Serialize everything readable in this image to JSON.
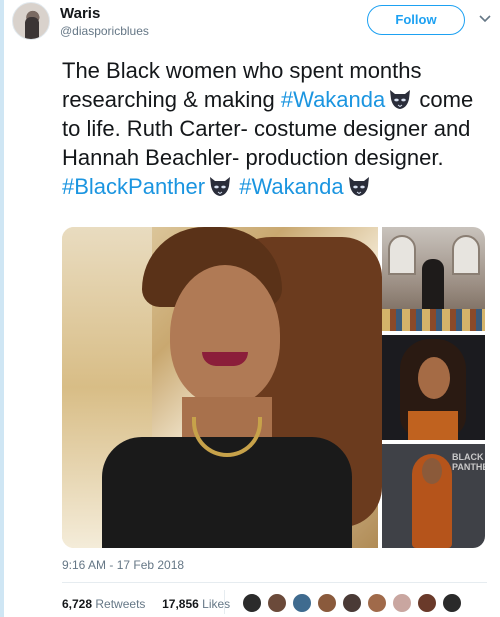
{
  "user": {
    "name": "Waris",
    "handle": "@diasporicblues"
  },
  "follow_button_label": "Follow",
  "tweet": {
    "segments": [
      {
        "text": "The Black women who spent months researching & making ",
        "type": "text"
      },
      {
        "text": "#Wakanda",
        "type": "hashtag"
      },
      {
        "text": "panther-emoji",
        "type": "emoji"
      },
      {
        "text": " come to life. Ruth Carter- costume designer and Hannah Beachler- production designer. ",
        "type": "text"
      },
      {
        "text": "#BlackPanther",
        "type": "hashtag"
      },
      {
        "text": "panther-emoji",
        "type": "emoji"
      },
      {
        "text": " ",
        "type": "text"
      },
      {
        "text": "#Wakanda",
        "type": "hashtag"
      },
      {
        "text": "panther-emoji",
        "type": "emoji"
      }
    ],
    "part1": "The Black women who spent months researching & making ",
    "hashtag1": "#Wakanda",
    "part2": " come to life. Ruth Carter- costume designer and Hannah Beachler- production designer. ",
    "hashtag2": "#BlackPanther",
    "hashtag3": "#Wakanda"
  },
  "media": {
    "main_photo": "woman-smiling-photo",
    "side_photos": [
      "studio-photo",
      "portrait-photo",
      "premiere-photo"
    ],
    "premiere_text": "BLACK PANTHER"
  },
  "timestamp": "9:16 AM - 17 Feb 2018",
  "stats": {
    "retweets_count": "6,728",
    "retweets_label": "Retweets",
    "likes_count": "17,856",
    "likes_label": "Likes"
  },
  "likers": [
    "#2b2b2b",
    "#6b4a3a",
    "#3f6b8f",
    "#8a5a3c",
    "#4a3a36",
    "#a06a4a",
    "#c9a6a0",
    "#6a3a2a",
    "#2a2a2a"
  ],
  "colors": {
    "accent": "#1da1f2",
    "hashtag": "#1b95e0",
    "muted": "#657786"
  }
}
